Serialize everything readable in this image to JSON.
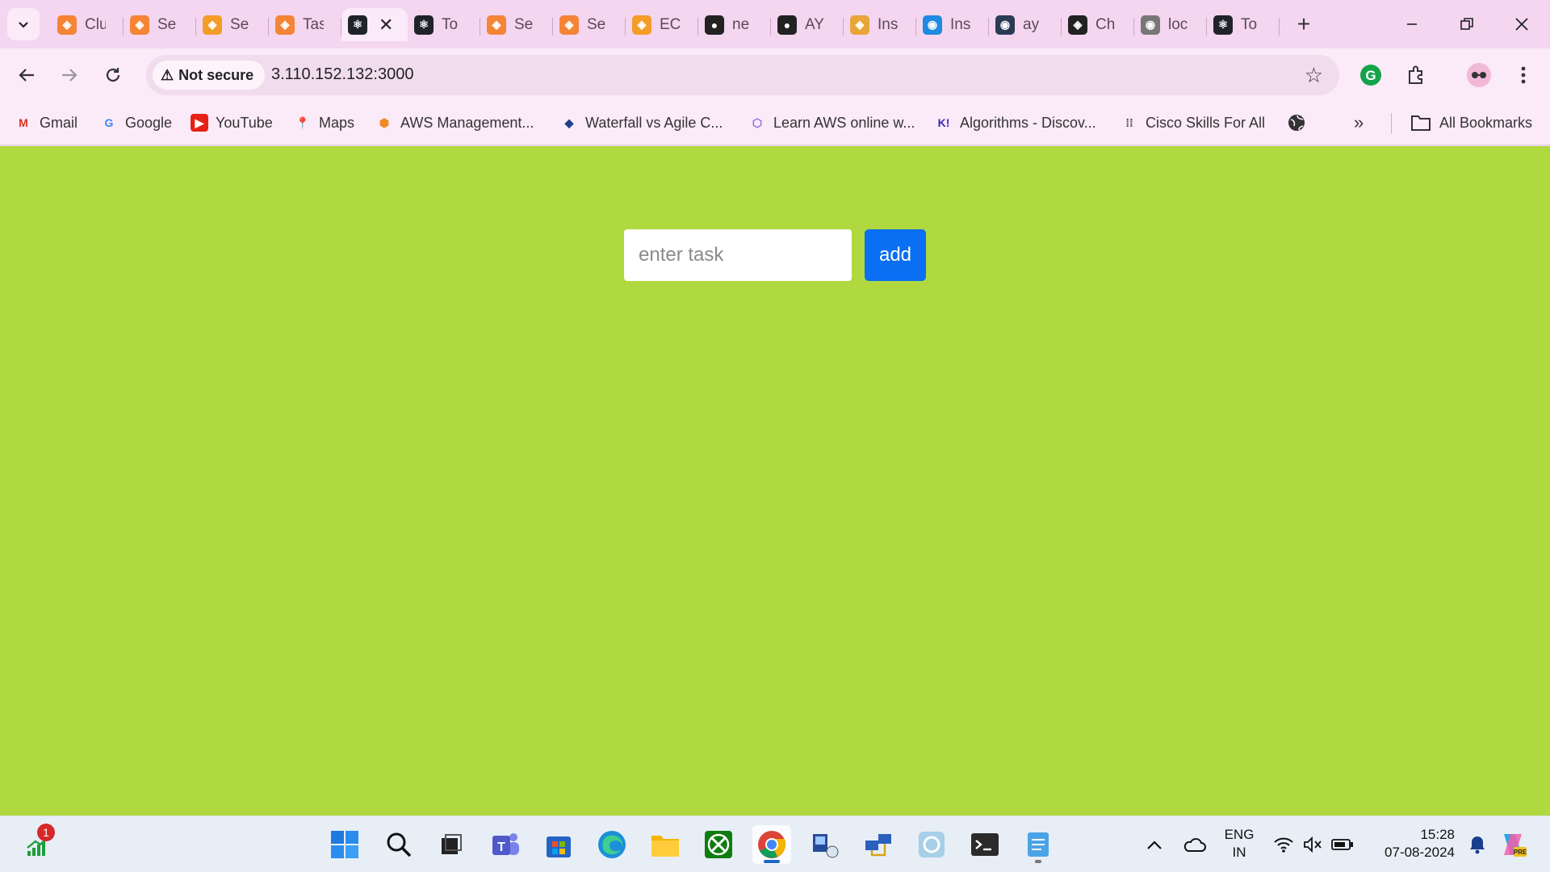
{
  "browser": {
    "tabs": [
      {
        "title": "Clu",
        "icon": "aws-orange-icon",
        "color": "#f58536",
        "active": false
      },
      {
        "title": "Se",
        "icon": "aws-orange-icon",
        "color": "#f58536",
        "active": false
      },
      {
        "title": "Se",
        "icon": "aws-cube-icon",
        "color": "#f39c28",
        "active": false
      },
      {
        "title": "Tas",
        "icon": "aws-orange-icon",
        "color": "#f58536",
        "active": false
      },
      {
        "title": "",
        "icon": "react-icon",
        "color": "#20232a",
        "active": true
      },
      {
        "title": "To",
        "icon": "react-icon",
        "color": "#20232a",
        "active": false
      },
      {
        "title": "Se",
        "icon": "aws-orange-icon",
        "color": "#f58536",
        "active": false
      },
      {
        "title": "Se",
        "icon": "aws-orange-icon",
        "color": "#f58536",
        "active": false
      },
      {
        "title": "EC",
        "icon": "aws-cube-icon",
        "color": "#f39c28",
        "active": false
      },
      {
        "title": "ne",
        "icon": "github-copilot-icon",
        "color": "#222222",
        "active": false
      },
      {
        "title": "AY",
        "icon": "github-icon",
        "color": "#222222",
        "active": false
      },
      {
        "title": "Ins",
        "icon": "book-icon",
        "color": "#e8a53a",
        "active": false
      },
      {
        "title": "Ins",
        "icon": "globe-blue-icon",
        "color": "#1f8ae0",
        "active": false
      },
      {
        "title": "ay",
        "icon": "globe-dark-icon",
        "color": "#2b3a55",
        "active": false
      },
      {
        "title": "Ch",
        "icon": "openai-icon",
        "color": "#222222",
        "active": false
      },
      {
        "title": "loc",
        "icon": "globe-grey-icon",
        "color": "#777777",
        "active": false
      },
      {
        "title": "To",
        "icon": "react-icon",
        "color": "#20232a",
        "active": false
      }
    ],
    "security_label": "Not secure",
    "url": "3.110.152.132:3000",
    "bookmarks": [
      {
        "label": "Gmail",
        "icon": "gmail-icon"
      },
      {
        "label": "Google",
        "icon": "google-icon"
      },
      {
        "label": "YouTube",
        "icon": "youtube-icon"
      },
      {
        "label": "Maps",
        "icon": "maps-icon"
      },
      {
        "label": "AWS Management...",
        "icon": "aws-cube-icon"
      },
      {
        "label": "Waterfall vs Agile C...",
        "icon": "diamond-icon"
      },
      {
        "label": "Learn AWS online w...",
        "icon": "cube-outline-icon"
      },
      {
        "label": "Algorithms - Discov...",
        "icon": "k-logo-icon"
      },
      {
        "label": "Cisco Skills For All",
        "icon": "cisco-icon"
      }
    ],
    "all_bookmarks_label": "All Bookmarks"
  },
  "app": {
    "background": "#b0d93f",
    "input_placeholder": "enter task",
    "input_value": "",
    "add_label": "add",
    "add_color": "#0a6ff2"
  },
  "taskbar": {
    "notification_badge": "1",
    "language_top": "ENG",
    "language_bottom": "IN",
    "time": "15:28",
    "date": "07-08-2024"
  }
}
